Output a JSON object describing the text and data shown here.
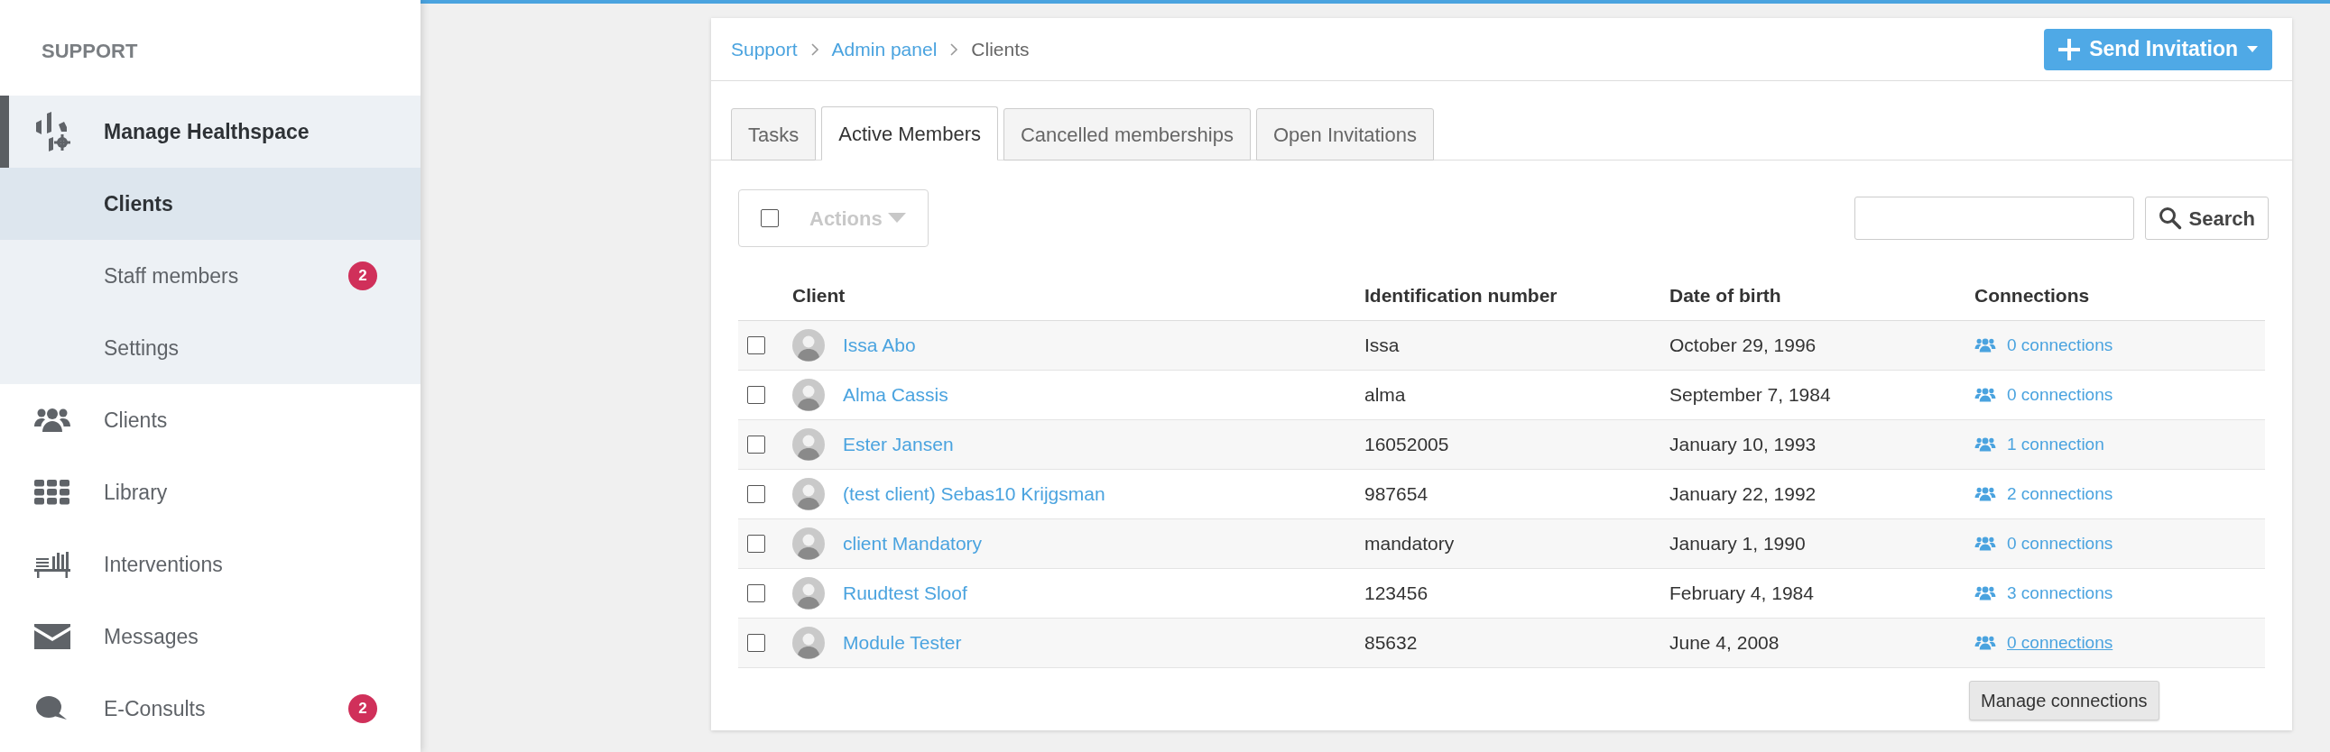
{
  "sidebar": {
    "heading": "SUPPORT",
    "items": [
      {
        "label": "Manage Healthspace",
        "expanded": true,
        "children": [
          {
            "label": "Clients",
            "selected": true
          },
          {
            "label": "Staff members",
            "selected": false,
            "badge": "2"
          },
          {
            "label": "Settings",
            "selected": false
          }
        ]
      },
      {
        "label": "Clients"
      },
      {
        "label": "Library"
      },
      {
        "label": "Interventions"
      },
      {
        "label": "Messages"
      },
      {
        "label": "E-Consults",
        "badge": "2"
      }
    ]
  },
  "breadcrumb": [
    {
      "label": "Support",
      "link": true
    },
    {
      "label": "Admin panel",
      "link": true
    },
    {
      "label": "Clients",
      "link": false
    }
  ],
  "send_button": {
    "label": "Send Invitation"
  },
  "tabs": [
    {
      "label": "Tasks",
      "selected": false
    },
    {
      "label": "Active Members",
      "selected": true
    },
    {
      "label": "Cancelled memberships",
      "selected": false
    },
    {
      "label": "Open Invitations",
      "selected": false
    }
  ],
  "toolbar": {
    "select_all_checked": false,
    "actions": {
      "label": "Actions",
      "disabled": true
    },
    "search": {
      "button": "Search"
    }
  },
  "table": {
    "columns": [
      "Client",
      "Identification number",
      "Date of birth",
      "Connections"
    ],
    "rows": [
      {
        "checked": false,
        "client": "Issa Abo",
        "id": "Issa",
        "dob": "October 29, 1996",
        "connections": "0 connections",
        "hovered": false
      },
      {
        "checked": false,
        "client": "Alma Cassis",
        "id": "alma",
        "dob": "September 7, 1984",
        "connections": "0 connections",
        "hovered": false
      },
      {
        "checked": false,
        "client": "Ester Jansen",
        "id": "16052005",
        "dob": "January 10, 1993",
        "connections": "1 connection",
        "hovered": false
      },
      {
        "checked": false,
        "client": "(test client) Sebas10 Krijgsman",
        "id": "987654",
        "dob": "January 22, 1992",
        "connections": "2 connections",
        "hovered": false
      },
      {
        "checked": false,
        "client": "client Mandatory",
        "id": "mandatory",
        "dob": "January 1, 1990",
        "connections": "0 connections",
        "hovered": false
      },
      {
        "checked": false,
        "client": "Ruudtest Sloof",
        "id": "123456",
        "dob": "February 4, 1984",
        "connections": "3 connections",
        "hovered": false
      },
      {
        "checked": false,
        "client": "Module Tester",
        "id": "85632",
        "dob": "June 4, 2008",
        "connections": "0 connections",
        "hovered": true
      }
    ],
    "tooltip": "Manage connections"
  }
}
